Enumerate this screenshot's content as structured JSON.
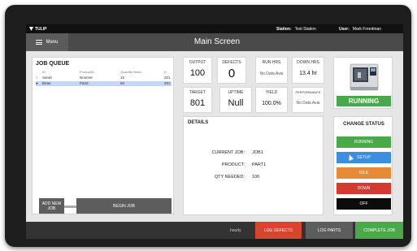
{
  "topbar": {
    "app_name": "TULIP",
    "station_label": "Station:",
    "station_value": "Test Station",
    "user_label": "User:",
    "user_value": "Mark Freedman"
  },
  "nav": {
    "menu_label": "Menu",
    "title": "Main Screen"
  },
  "job_queue": {
    "title": "JOB QUEUE",
    "columns": [
      "ID",
      "ProductID",
      "Quantity Need...",
      "D"
    ],
    "rows": [
      {
        "id": "Sarah",
        "product": "Broener",
        "quantity": "10",
        "d": "201",
        "selected": false
      },
      {
        "id": "Brian",
        "product": "Part2",
        "quantity": "50",
        "d": "201",
        "selected": true
      }
    ],
    "add_new_label": "ADD NEW JOB",
    "begin_label": "BEGIN JOB"
  },
  "metrics": {
    "output": {
      "label": "OUTPUT",
      "value": "100"
    },
    "defects": {
      "label": "DEFECTS",
      "value": "0"
    },
    "run_hrs": {
      "label": "RUN HRS",
      "value": "No Data Avai"
    },
    "down_hrs": {
      "label": "DOWN HRS",
      "value": "13.4 hr"
    },
    "target": {
      "label": "TARGET",
      "value": "801"
    },
    "uptime": {
      "label": "UPTIME",
      "value": "Null"
    },
    "yield": {
      "label": "YIELD",
      "value": "100.0%"
    },
    "performance": {
      "label": "PERFORMANCE",
      "value": "No Data Avai"
    }
  },
  "details": {
    "title": "DETAILS",
    "current_job_label": "CURRENT JOB:",
    "current_job": "JOB1",
    "product_label": "PRODUCT:",
    "product": "PART1",
    "qty_label": "QTY NEEDED:",
    "qty": "100"
  },
  "machine": {
    "status": "RUNNING"
  },
  "change_status": {
    "title": "CHANGE STATUS",
    "buttons": [
      {
        "label": "RUNNING",
        "color": "#4aa84a"
      },
      {
        "label": "SETUP",
        "color": "#3c8ee0"
      },
      {
        "label": "IDLE",
        "color": "#e58a35"
      },
      {
        "label": "DOWN",
        "color": "#d43a2f"
      },
      {
        "label": "OFF",
        "color": "#0c0c0c"
      }
    ]
  },
  "bottom": {
    "hourly_label": "hourly",
    "log_defects": "LOG DEFECTS",
    "log_parts": "LOG PARTS",
    "complete_job": "COMPLETE JOB"
  },
  "colors": {
    "accent_green": "#4aa84a",
    "log_defects": "#d8452f",
    "log_parts": "#5d5d5d",
    "complete_job": "#4aa84a"
  }
}
